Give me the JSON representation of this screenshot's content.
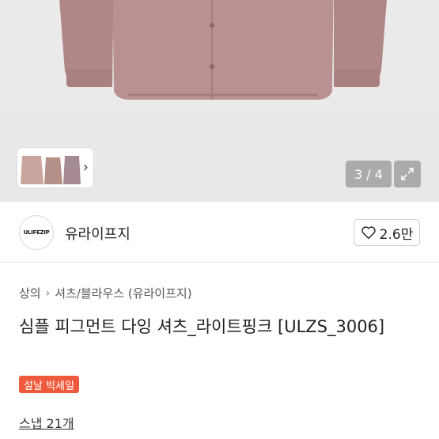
{
  "gallery": {
    "counter": "3 / 4",
    "shirt_color": "#b99090"
  },
  "shop": {
    "logo_text": "ULIFEZIP",
    "name": "유라이프지",
    "likes": "2.6만"
  },
  "breadcrumb": {
    "items": [
      "상의",
      "셔츠/블라우스 (유라이프지)"
    ]
  },
  "product": {
    "title": "심플 피그먼트 다잉 셔츠_라이트핑크 [ULZS_3006]",
    "badge": "설날 빅세일",
    "snap_link": "스냅 21개"
  },
  "colors": {
    "badge": "#f05a3c",
    "hero_bg": "#ebebeb"
  }
}
